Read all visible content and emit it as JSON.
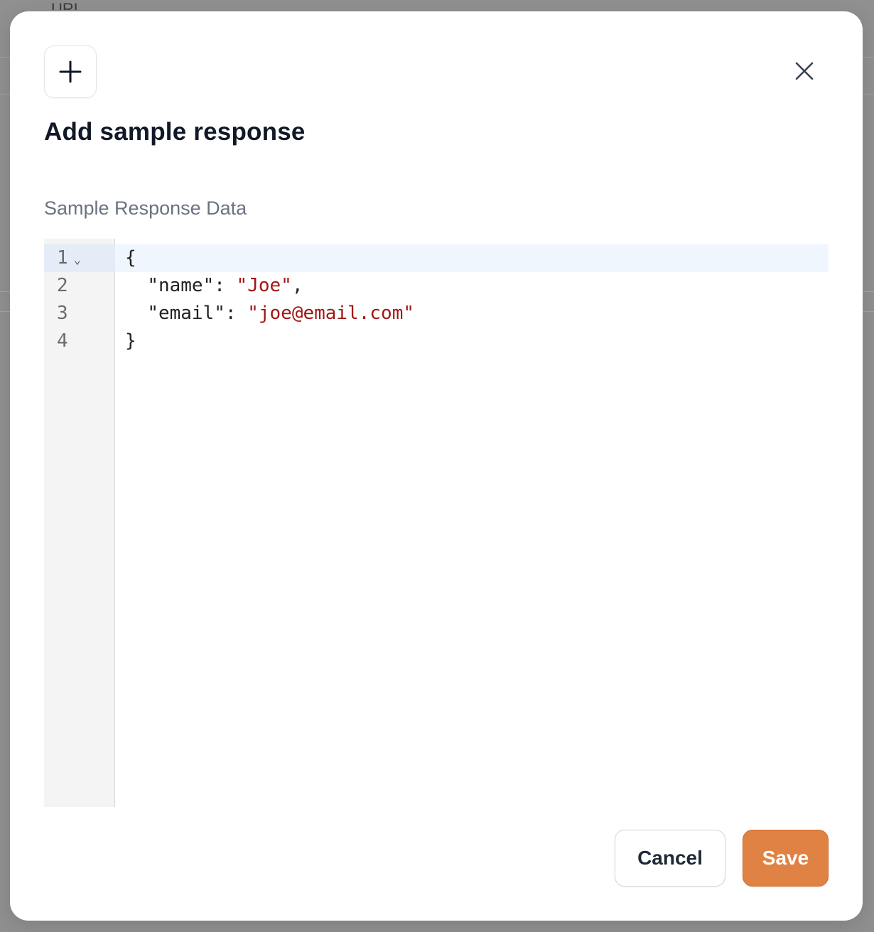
{
  "background": {
    "partial_text": "URL"
  },
  "modal": {
    "header_icon": "plus-icon",
    "close_icon": "close-icon",
    "title": "Add sample response",
    "field_label": "Sample Response Data",
    "editor": {
      "line_numbers": [
        "1",
        "2",
        "3",
        "4"
      ],
      "fold_marker": "⌄",
      "lines": {
        "l1_brace": "{",
        "l2_key": "\"name\"",
        "l2_sep": ": ",
        "l2_value": "\"Joe\"",
        "l2_comma": ",",
        "l3_key": "\"email\"",
        "l3_sep": ": ",
        "l3_value": "\"joe@email.com\"",
        "l4_brace": "}"
      }
    },
    "buttons": {
      "cancel_label": "Cancel",
      "save_label": "Save"
    }
  },
  "colors": {
    "accent": "#e08244",
    "string_value": "#a31515",
    "title": "#111827",
    "label": "#6b7280"
  }
}
